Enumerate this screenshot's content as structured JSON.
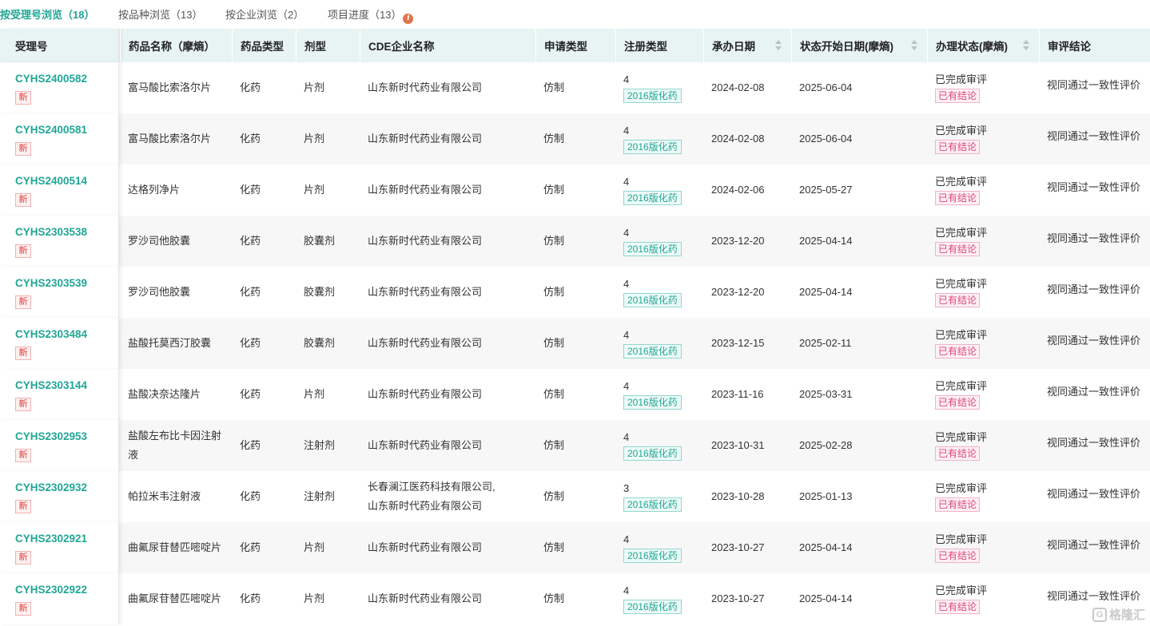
{
  "tabs": [
    {
      "label": "按受理号浏览（18）",
      "active": true
    },
    {
      "label": "按品种浏览（13）",
      "active": false
    },
    {
      "label": "按企业浏览（2）",
      "active": false
    },
    {
      "label": "项目进度（13）",
      "active": false
    }
  ],
  "info_icon": "i",
  "columns": [
    "受理号",
    "药品名称（摩熵）",
    "药品类型",
    "剂型",
    "CDE企业名称",
    "申请类型",
    "注册类型",
    "承办日期",
    "状态开始日期(摩熵)",
    "办理状态(摩熵)",
    "审评结论"
  ],
  "new_badge": "新",
  "rows": [
    {
      "acc": "CYHS2400582",
      "name": "富马酸比索洛尔片",
      "type": "化药",
      "form": "片剂",
      "company": "山东新时代药业有限公司",
      "app": "仿制",
      "reg_num": "4",
      "reg_tag": "2016版化药",
      "date": "2024-02-08",
      "start": "2025-06-04",
      "status": "已完成审评",
      "status_tag": "已有结论",
      "conclusion": "视同通过一致性评价"
    },
    {
      "acc": "CYHS2400581",
      "name": "富马酸比索洛尔片",
      "type": "化药",
      "form": "片剂",
      "company": "山东新时代药业有限公司",
      "app": "仿制",
      "reg_num": "4",
      "reg_tag": "2016版化药",
      "date": "2024-02-08",
      "start": "2025-06-04",
      "status": "已完成审评",
      "status_tag": "已有结论",
      "conclusion": "视同通过一致性评价"
    },
    {
      "acc": "CYHS2400514",
      "name": "达格列净片",
      "type": "化药",
      "form": "片剂",
      "company": "山东新时代药业有限公司",
      "app": "仿制",
      "reg_num": "4",
      "reg_tag": "2016版化药",
      "date": "2024-02-06",
      "start": "2025-05-27",
      "status": "已完成审评",
      "status_tag": "已有结论",
      "conclusion": "视同通过一致性评价"
    },
    {
      "acc": "CYHS2303538",
      "name": "罗沙司他胶囊",
      "type": "化药",
      "form": "胶囊剂",
      "company": "山东新时代药业有限公司",
      "app": "仿制",
      "reg_num": "4",
      "reg_tag": "2016版化药",
      "date": "2023-12-20",
      "start": "2025-04-14",
      "status": "已完成审评",
      "status_tag": "已有结论",
      "conclusion": "视同通过一致性评价"
    },
    {
      "acc": "CYHS2303539",
      "name": "罗沙司他胶囊",
      "type": "化药",
      "form": "胶囊剂",
      "company": "山东新时代药业有限公司",
      "app": "仿制",
      "reg_num": "4",
      "reg_tag": "2016版化药",
      "date": "2023-12-20",
      "start": "2025-04-14",
      "status": "已完成审评",
      "status_tag": "已有结论",
      "conclusion": "视同通过一致性评价"
    },
    {
      "acc": "CYHS2303484",
      "name": "盐酸托莫西汀胶囊",
      "type": "化药",
      "form": "胶囊剂",
      "company": "山东新时代药业有限公司",
      "app": "仿制",
      "reg_num": "4",
      "reg_tag": "2016版化药",
      "date": "2023-12-15",
      "start": "2025-02-11",
      "status": "已完成审评",
      "status_tag": "已有结论",
      "conclusion": "视同通过一致性评价"
    },
    {
      "acc": "CYHS2303144",
      "name": "盐酸决奈达隆片",
      "type": "化药",
      "form": "片剂",
      "company": "山东新时代药业有限公司",
      "app": "仿制",
      "reg_num": "4",
      "reg_tag": "2016版化药",
      "date": "2023-11-16",
      "start": "2025-03-31",
      "status": "已完成审评",
      "status_tag": "已有结论",
      "conclusion": "视同通过一致性评价"
    },
    {
      "acc": "CYHS2302953",
      "name": "盐酸左布比卡因注射液",
      "type": "化药",
      "form": "注射剂",
      "company": "山东新时代药业有限公司",
      "app": "仿制",
      "reg_num": "4",
      "reg_tag": "2016版化药",
      "date": "2023-10-31",
      "start": "2025-02-28",
      "status": "已完成审评",
      "status_tag": "已有结论",
      "conclusion": "视同通过一致性评价"
    },
    {
      "acc": "CYHS2302932",
      "name": "帕拉米韦注射液",
      "type": "化药",
      "form": "注射剂",
      "company": "长春澜江医药科技有限公司,山东新时代药业有限公司",
      "app": "仿制",
      "reg_num": "3",
      "reg_tag": "2016版化药",
      "date": "2023-10-28",
      "start": "2025-01-13",
      "status": "已完成审评",
      "status_tag": "已有结论",
      "conclusion": "视同通过一致性评价"
    },
    {
      "acc": "CYHS2302921",
      "name": "曲氟尿苷替匹嘧啶片",
      "type": "化药",
      "form": "片剂",
      "company": "山东新时代药业有限公司",
      "app": "仿制",
      "reg_num": "4",
      "reg_tag": "2016版化药",
      "date": "2023-10-27",
      "start": "2025-04-14",
      "status": "已完成审评",
      "status_tag": "已有结论",
      "conclusion": "视同通过一致性评价"
    },
    {
      "acc": "CYHS2302922",
      "name": "曲氟尿苷替匹嘧啶片",
      "type": "化药",
      "form": "片剂",
      "company": "山东新时代药业有限公司",
      "app": "仿制",
      "reg_num": "4",
      "reg_tag": "2016版化药",
      "date": "2023-10-27",
      "start": "2025-04-14",
      "status": "已完成审评",
      "status_tag": "已有结论",
      "conclusion": "视同通过一致性评价"
    }
  ],
  "watermark": "格隆汇",
  "colors": {
    "accent": "#1fa695",
    "header_bg": "#e8f3f3",
    "new_red": "#e03c3c",
    "tag_pink": "#e0457a"
  }
}
